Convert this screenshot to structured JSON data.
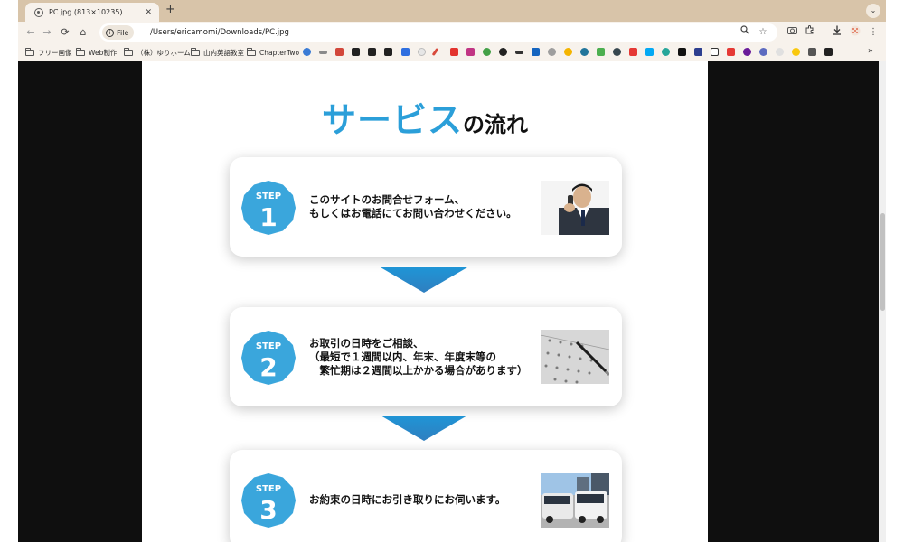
{
  "browser": {
    "tab_title": "PC.jpg (813×10235)",
    "tab_close": "✕",
    "new_tab": "+",
    "address_chip": "File",
    "address": "/Users/ericamomi/Downloads/PC.jpg"
  },
  "bookmarks": {
    "folders": [
      "フリー画像",
      "Web制作",
      "（株）ゆりホーム",
      "山内英語教室",
      "ChapterTwo"
    ],
    "more": "»"
  },
  "page": {
    "title_highlight": "サービス",
    "title_rest": "の流れ",
    "step_word": "STEP",
    "steps": [
      {
        "number": "1",
        "lines": [
          "このサイトのお問合せフォーム、",
          "もしくはお電話にてお問い合わせください。"
        ],
        "photo": "man-on-phone-photo"
      },
      {
        "number": "2",
        "lines": [
          "お取引の日時をご相談、",
          "（最短で１週間以内、年末、年度末等の",
          "　繁忙期は２週間以上かかる場合があります）"
        ],
        "photo": "calendar-photo"
      },
      {
        "number": "3",
        "lines": [
          "お約束の日時にお引き取りにお伺います。"
        ],
        "photo": "parked-vans-photo"
      }
    ]
  },
  "colors": {
    "accent": "#2b9fd9",
    "badge": "#3aa6dc",
    "arrow_top": "#1f95d6",
    "arrow_bottom": "#2f7fc0"
  }
}
